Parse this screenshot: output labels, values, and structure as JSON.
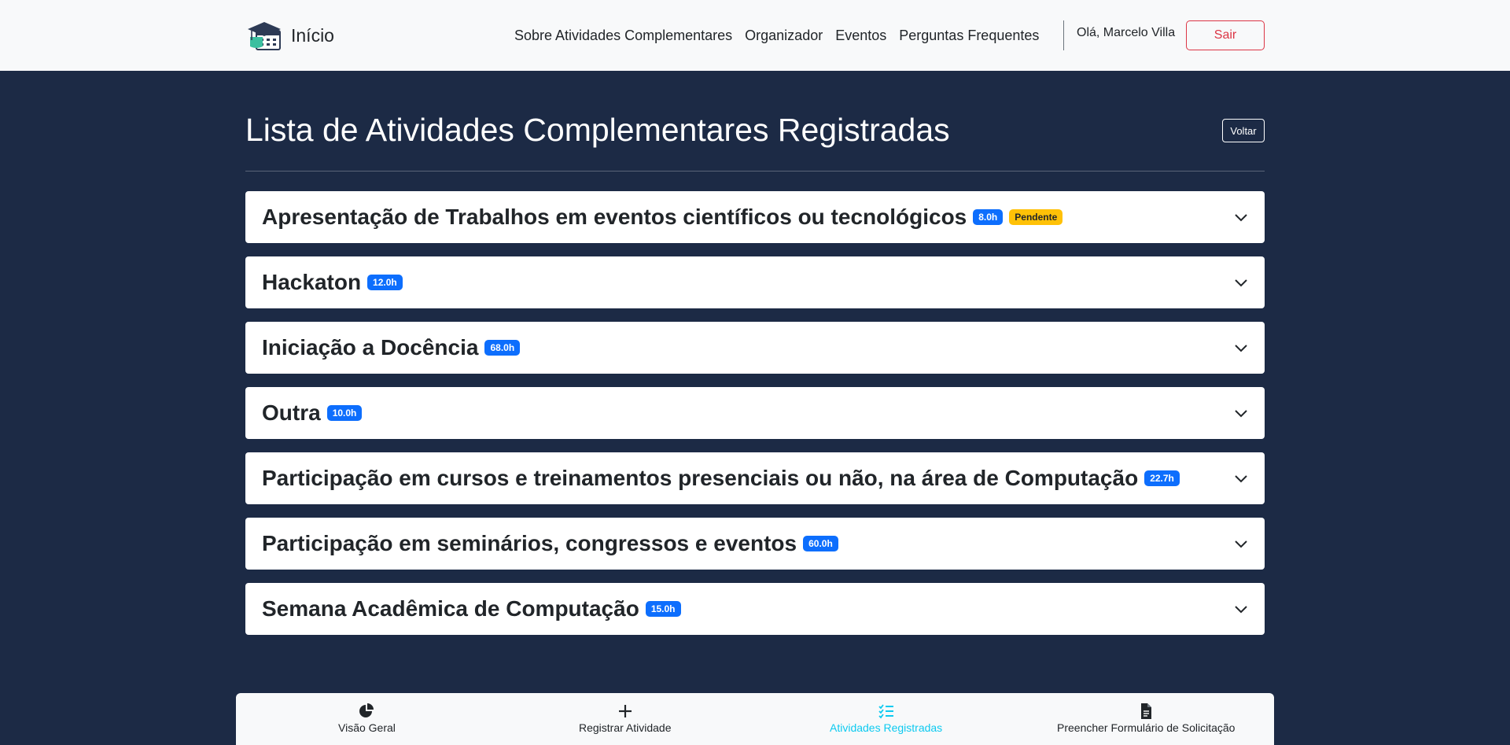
{
  "header": {
    "brand": "Início",
    "nav": [
      "Sobre Atividades Complementares",
      "Organizador",
      "Eventos",
      "Perguntas Frequentes"
    ],
    "greeting": "Olá, Marcelo Villa",
    "logout_label": "Sair"
  },
  "page": {
    "title": "Lista de Atividades Complementares Registradas",
    "back_label": "Voltar"
  },
  "activities": [
    {
      "title": "Apresentação de Trabalhos em eventos científicos ou tecnológicos",
      "hours": "8.0h",
      "status": "Pendente"
    },
    {
      "title": "Hackaton",
      "hours": "12.0h"
    },
    {
      "title": "Iniciação a Docência",
      "hours": "68.0h"
    },
    {
      "title": "Outra",
      "hours": "10.0h"
    },
    {
      "title": "Participação em cursos e treinamentos presenciais ou não, na área de Computação",
      "hours": "22.7h"
    },
    {
      "title": "Participação em seminários, congressos e eventos",
      "hours": "60.0h"
    },
    {
      "title": "Semana Acadêmica de Computação",
      "hours": "15.0h"
    }
  ],
  "bottom_nav": [
    {
      "label": "Visão Geral",
      "icon": "pie-chart-icon",
      "active": false
    },
    {
      "label": "Registrar Atividade",
      "icon": "plus-icon",
      "active": false
    },
    {
      "label": "Atividades Registradas",
      "icon": "checklist-icon",
      "active": true
    },
    {
      "label": "Preencher Formulário de Solicitação",
      "icon": "document-icon",
      "active": false
    }
  ],
  "colors": {
    "background": "#1c2a45",
    "hours_badge": "#0d6efd",
    "pending_badge": "#ffc107",
    "logout": "#dc3545",
    "active_tab": "#0dcaf0"
  }
}
